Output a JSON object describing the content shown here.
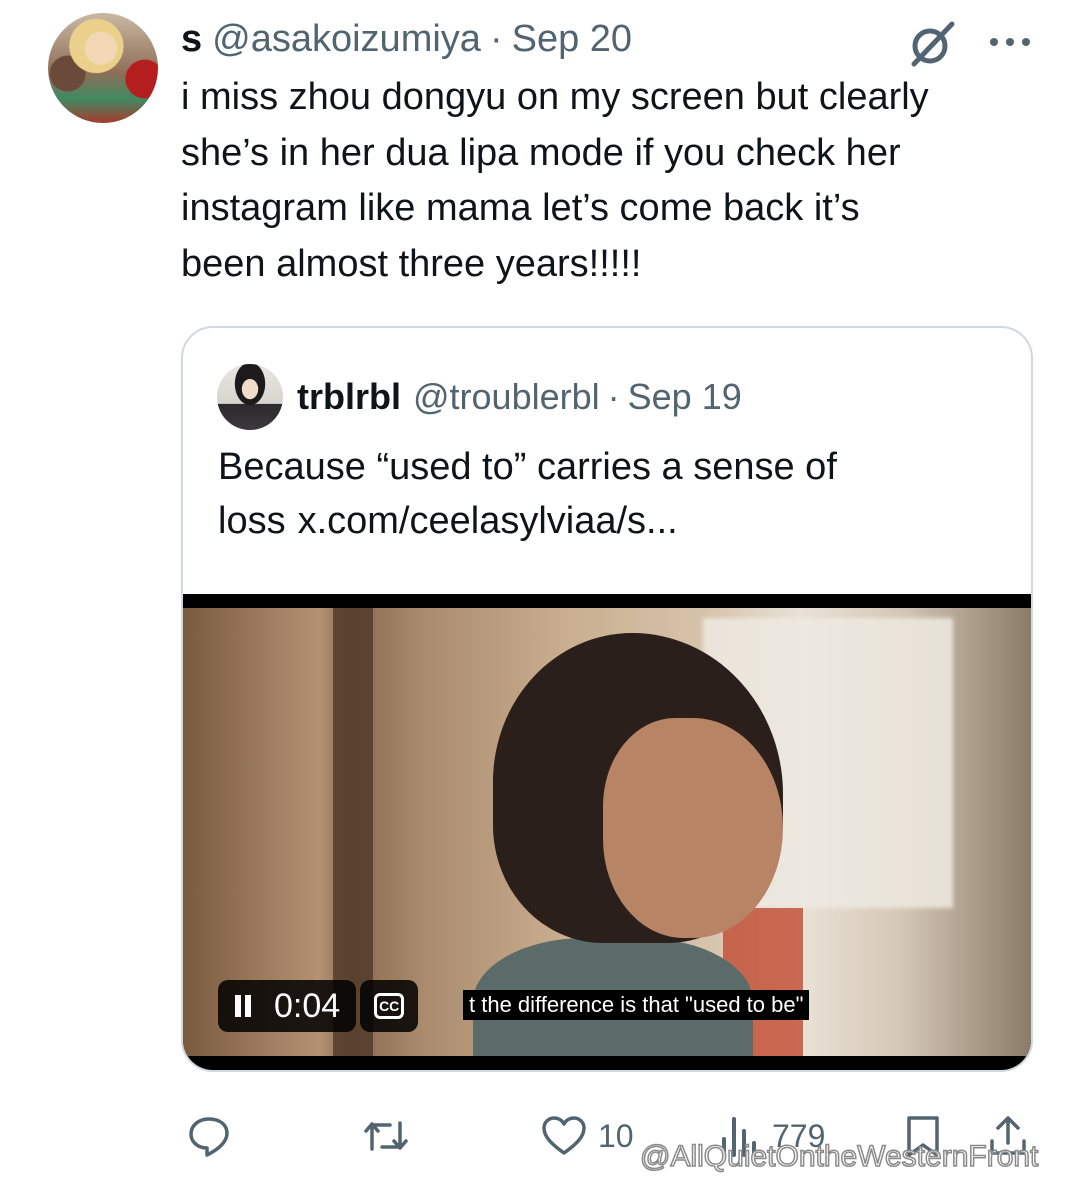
{
  "tweet": {
    "name": "s",
    "handle": "@asakoizumiya",
    "separator": "·",
    "date": "Sep 20",
    "text_lines": [
      "i miss zhou dongyu on my screen but clearly",
      "she’s in her dua lipa mode if you check her",
      "instagram like mama let’s come back it’s",
      "been almost three years!!!!!"
    ]
  },
  "quoted": {
    "name": "trblrbl",
    "handle": "@troublerbl",
    "separator": "·",
    "date": "Sep 19",
    "text_line1": "Because “used to” carries a sense of",
    "text_line2_prefix": "loss",
    "text_link": "x.com/ceelasylviaa/s...",
    "video": {
      "time": "0:04",
      "cc_label": "CC",
      "subtitle": "t the difference is that \"used to be\""
    }
  },
  "actions": {
    "likes": "10",
    "views": "779"
  },
  "watermark": "@AllQuietOntheWesternFront",
  "icons": [
    "grok-icon",
    "more-icon",
    "pause-icon",
    "cc-icon",
    "reply-icon",
    "retweet-icon",
    "like-icon",
    "views-icon",
    "bookmark-icon",
    "share-icon"
  ]
}
